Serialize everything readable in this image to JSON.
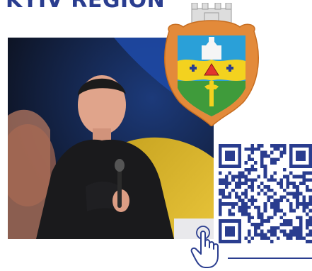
{
  "header": {
    "region_title": "KYIV REGION"
  },
  "colors": {
    "brand_blue": "#2a3d8f",
    "coat_orange": "#e38a3a",
    "coat_blue": "#2aa0d8",
    "coat_green": "#3f9b3b",
    "coat_yellow": "#f3d21f"
  },
  "icons": {
    "coat_of_arms": "coat-of-arms-icon",
    "qr_code": "qr-code-icon",
    "pointer": "hand-pointer-icon"
  }
}
